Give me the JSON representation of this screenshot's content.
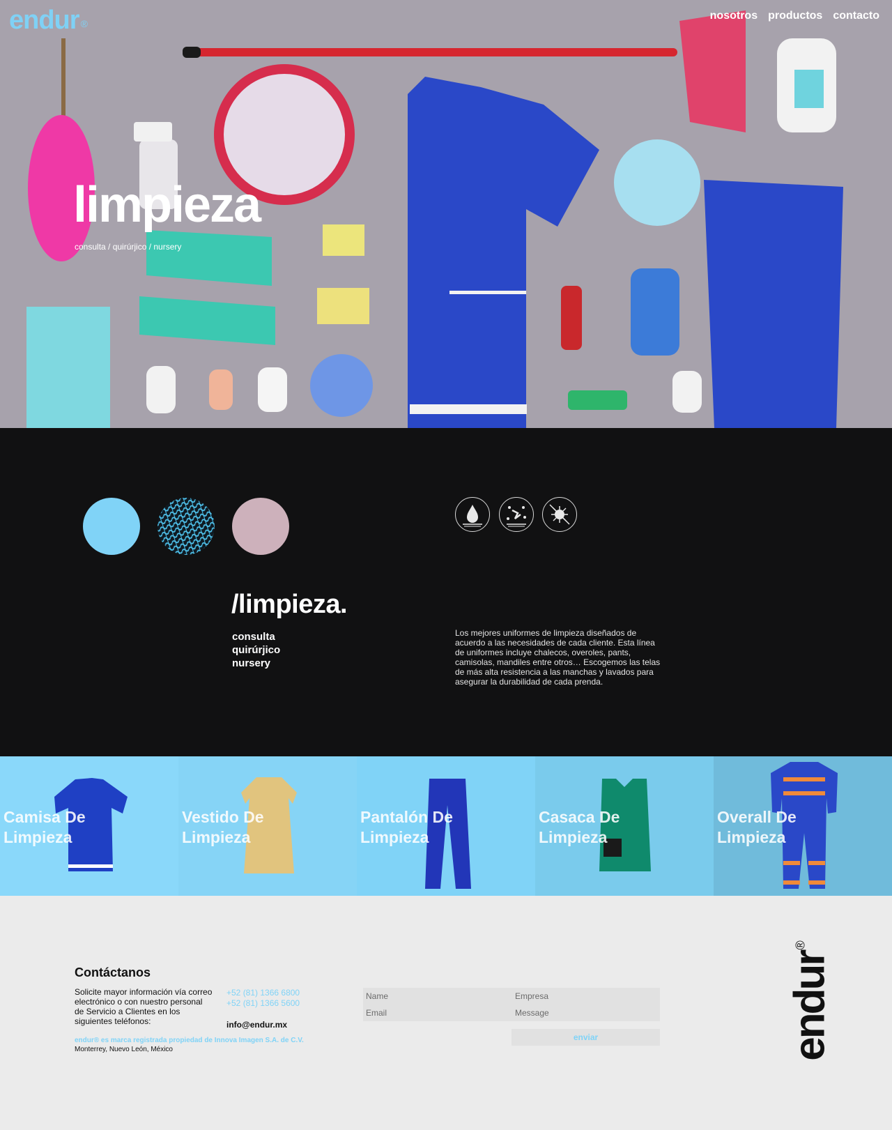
{
  "header": {
    "logo": "endur",
    "logo_mark": "®",
    "nav": [
      "nosotros",
      "productos",
      "contacto"
    ]
  },
  "hero": {
    "title": "limpieza",
    "subtitle": "consulta / quirúrjico / nursery"
  },
  "colors": {
    "accent": "#80d3f7",
    "dark": "#111112",
    "mesh": "#4fc2ec",
    "rose": "#cdb1bb",
    "footer_bg": "#ebebeb"
  },
  "swatches": [
    "light-blue-fabric",
    "mesh-pattern-fabric",
    "rose-fabric"
  ],
  "features": [
    "water-drop-icon",
    "stain-icon",
    "anti-bacterial-icon"
  ],
  "section": {
    "title": "/limpieza.",
    "list": [
      "consulta",
      "quirúrjico",
      "nursery"
    ],
    "description": "Los mejores uniformes de limpieza diseñados de acuerdo a las necesidades de cada cliente. Esta línea de uniformes incluye chalecos, overoles, pants, camisolas, mandiles entre otros… Escogemos las telas de más alta resistencia a las manchas y lavados para asegurar la durabilidad de cada prenda."
  },
  "products": [
    {
      "line1": "Camisa De",
      "line2": "Limpieza",
      "bg": "#8ad8fa"
    },
    {
      "line1": "Vestido De",
      "line2": "Limpieza",
      "bg": "#86d4f6"
    },
    {
      "line1": "Pantalón De",
      "line2": "Limpieza",
      "bg": "#80d3f7"
    },
    {
      "line1": "Casaca De",
      "line2": "Limpieza",
      "bg": "#7acbec"
    },
    {
      "line1": "Overall De",
      "line2": "Limpieza",
      "bg": "#70bbdb"
    }
  ],
  "contact": {
    "title": "Contáctanos",
    "text": "Solicite mayor información vía correo electrónico o con nuestro personal de Servicio a Clientes en los siguientes teléfonos:",
    "phones": [
      "+52 (81) 1366 6800",
      "+52 (81) 1366 5600"
    ],
    "email": "info@endur.mx",
    "brand_note": "endur® es marca registrada propiedad de Innova Imagen S.A. de C.V.",
    "address": "Monterrey, Nuevo León, México",
    "form": {
      "name_placeholder": "Name",
      "company_placeholder": "Empresa",
      "email_placeholder": "Email",
      "message_placeholder": "Message",
      "submit_label": "enviar"
    },
    "vertical_logo": "endur",
    "vertical_logo_mark": "®"
  }
}
